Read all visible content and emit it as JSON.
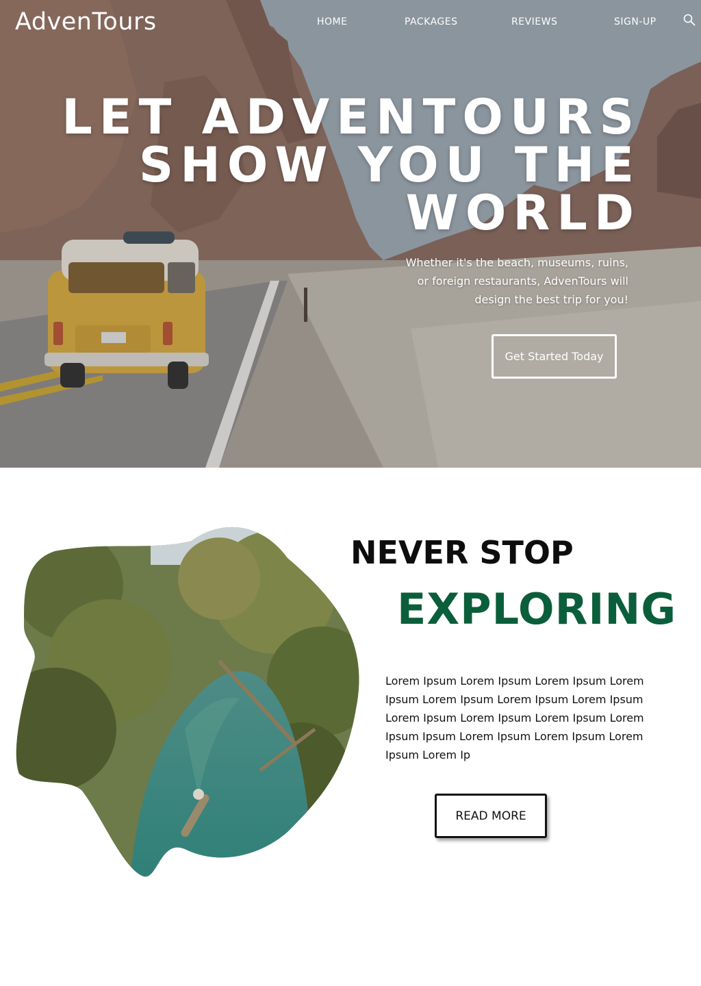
{
  "header": {
    "logo": "AdvenTours",
    "nav": [
      {
        "label": "HOME"
      },
      {
        "label": "PACKAGES"
      },
      {
        "label": "REVIEWS"
      },
      {
        "label": "SIGN-UP"
      }
    ],
    "search_icon": "search-icon"
  },
  "hero": {
    "title_lines": [
      "LET ADVENTOURS",
      "SHOW YOU THE",
      "WORLD"
    ],
    "subtitle": "Whether it's the beach, museums, ruins, or foreign restaurants, AdvenTours will design the best trip for you!",
    "cta_label": "Get Started Today",
    "image": "desert road with yellow van"
  },
  "explore": {
    "heading_line1": "NEVER STOP",
    "heading_line2": "EXPLORING",
    "body": "Lorem Ipsum Lorem Ipsum Lorem Ipsum Lorem Ipsum Lorem Ipsum Lorem Ipsum Lorem Ipsum Lorem Ipsum Lorem Ipsum Lorem Ipsum Lorem Ipsum Ipsum Lorem Ipsum Lorem Ipsum Lorem Ipsum Lorem Ip",
    "button_label": "READ MORE",
    "image": "tropical river with palm trees and canoe"
  },
  "colors": {
    "accent_green": "#0b5e3b",
    "hero_text": "#ffffff",
    "body_text": "#111111"
  }
}
